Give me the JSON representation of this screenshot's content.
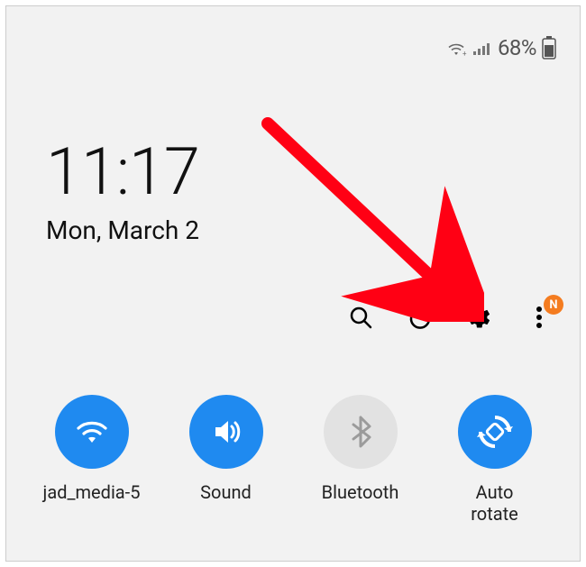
{
  "status": {
    "battery_pct": "68%"
  },
  "clock": {
    "time": "11:17",
    "date": "Mon, March 2"
  },
  "badges": {
    "notification_letter": "N"
  },
  "qs": {
    "wifi": {
      "label": "jad_media-5",
      "on": true
    },
    "sound": {
      "label": "Sound",
      "on": true
    },
    "bluetooth": {
      "label": "Bluetooth",
      "on": false
    },
    "auto_rotate": {
      "label": "Auto\nrotate",
      "on": true
    }
  },
  "colors": {
    "accent": "#1f8af0",
    "badge": "#f47c20",
    "arrow": "#ff0014"
  }
}
